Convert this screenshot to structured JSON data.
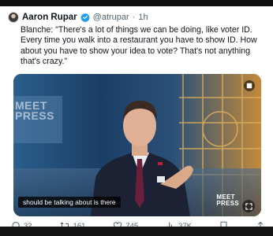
{
  "tweet": {
    "author": "Aaron Rupar",
    "handle": "@atrupar",
    "separator": "·",
    "time": "1h",
    "text": "Blanche: \"There's a lot of things we can be doing, like voter ID. Every time you walk into a restaurant you have to show ID. How about you have to show your idea to vote? That's not anything that's crazy.\""
  },
  "media": {
    "caption": "should be talking about is there",
    "logo_text_line1": "MEET",
    "logo_text_line2": "PRESS"
  },
  "actions": {
    "replies": "32",
    "reposts": "161",
    "likes": "745",
    "views": "37K"
  },
  "colors": {
    "verified": "#1d9bf0",
    "text_secondary": "#536471",
    "suit": "#1c2233",
    "tie": "#6a1f3c"
  }
}
